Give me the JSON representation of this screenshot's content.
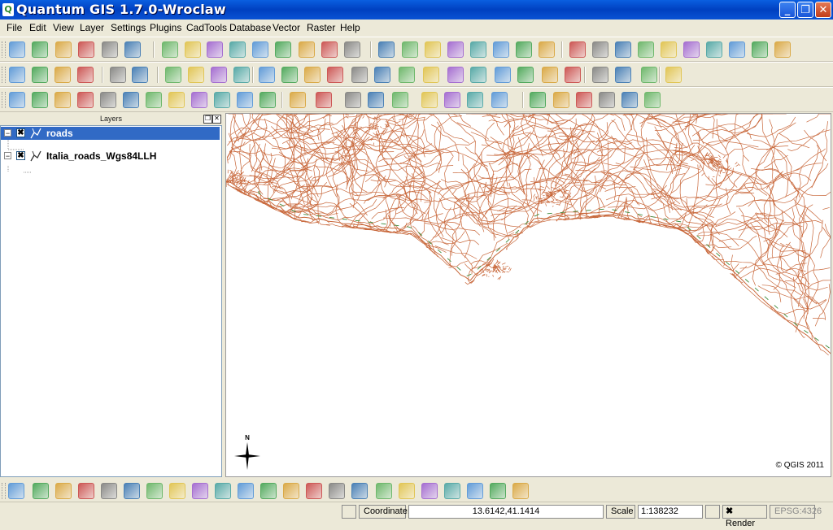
{
  "window": {
    "title": "Quantum GIS 1.7.0-Wroclaw"
  },
  "menu": [
    "File",
    "Edit",
    "View",
    "Layer",
    "Settings",
    "Plugins",
    "CadTools",
    "Database",
    "Vector",
    "Raster",
    "Help"
  ],
  "layers_panel": {
    "title": "Layers",
    "layers": [
      {
        "name": "roads",
        "checked": "✖",
        "selected": true
      },
      {
        "name": "Italia_roads_Wgs84LLH",
        "checked": "✖",
        "selected": false
      }
    ]
  },
  "map": {
    "north_label": "N",
    "copyright": "© QGIS 2011",
    "road_color": "#c8673a",
    "highway_color": "#3a8a3a"
  },
  "status": {
    "coordinate_label": "Coordinate:",
    "coordinate_value": "13.6142,41.1414",
    "scale_label": "Scale",
    "scale_value": "1:138232",
    "render_label": "Render",
    "render_checked": "✖",
    "crs": "EPSG:4326"
  }
}
